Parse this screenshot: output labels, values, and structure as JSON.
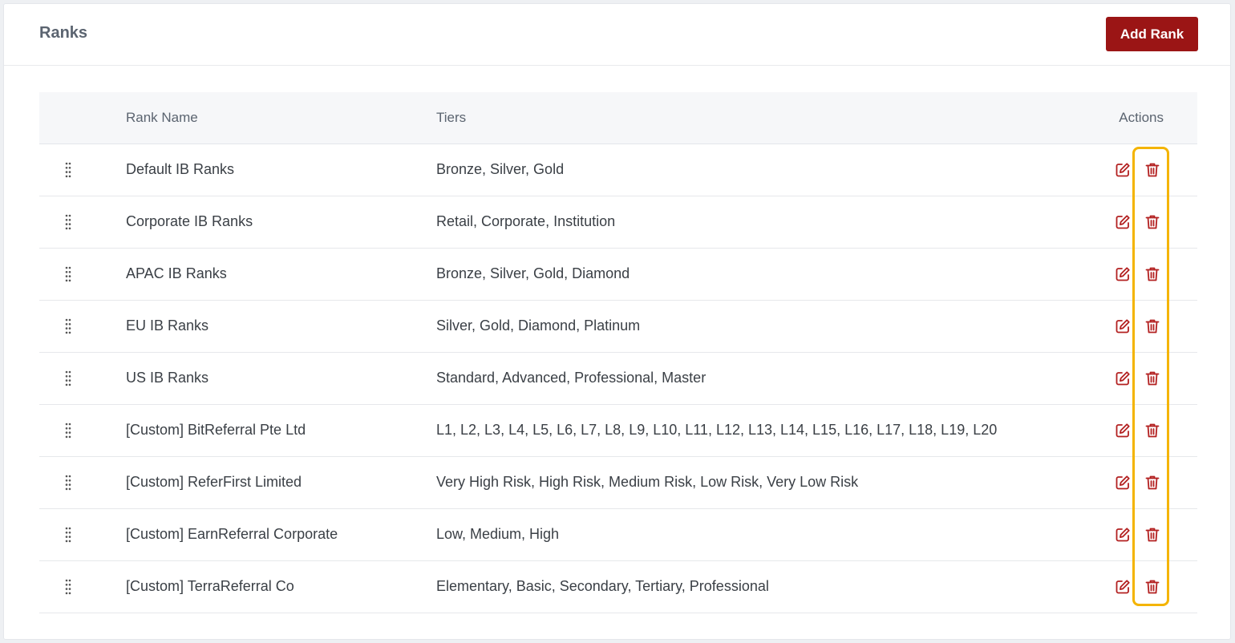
{
  "header": {
    "title": "Ranks",
    "add_button_label": "Add Rank"
  },
  "table": {
    "columns": {
      "name": "Rank Name",
      "tiers": "Tiers",
      "actions": "Actions"
    },
    "rows": [
      {
        "name": "Default IB Ranks",
        "tiers": "Bronze, Silver, Gold"
      },
      {
        "name": "Corporate IB Ranks",
        "tiers": "Retail, Corporate, Institution"
      },
      {
        "name": "APAC IB Ranks",
        "tiers": "Bronze, Silver, Gold, Diamond"
      },
      {
        "name": "EU IB Ranks",
        "tiers": "Silver, Gold, Diamond, Platinum"
      },
      {
        "name": "US IB Ranks",
        "tiers": "Standard, Advanced, Professional, Master"
      },
      {
        "name": "[Custom] BitReferral Pte Ltd",
        "tiers": "L1, L2, L3, L4, L5, L6, L7, L8, L9, L10, L11, L12, L13, L14, L15, L16, L17, L18, L19, L20"
      },
      {
        "name": "[Custom] ReferFirst Limited",
        "tiers": "Very High Risk, High Risk, Medium Risk, Low Risk, Very Low Risk"
      },
      {
        "name": "[Custom] EarnReferral Corporate",
        "tiers": "Low, Medium, High"
      },
      {
        "name": "[Custom] TerraReferral Co",
        "tiers": "Elementary, Basic, Secondary, Tertiary, Professional"
      }
    ]
  },
  "icons": {
    "drag_handle": "drag-handle-icon",
    "edit": "edit-icon",
    "delete": "trash-icon"
  },
  "colors": {
    "accent": "#9b1515",
    "highlight": "#f4b400"
  }
}
